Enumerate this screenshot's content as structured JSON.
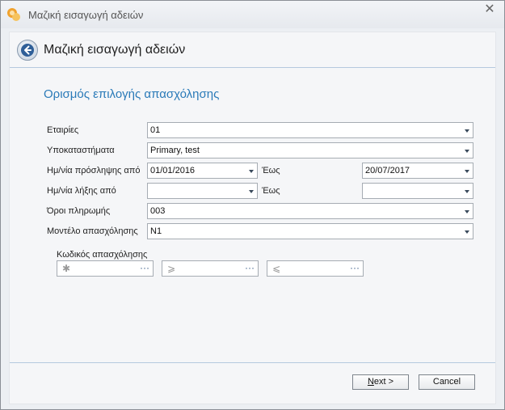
{
  "window": {
    "title": "Μαζική εισαγωγή αδειών",
    "close_glyph": "✕"
  },
  "header": {
    "title": "Μαζική εισαγωγή αδειών"
  },
  "section": {
    "title": "Ορισμός επιλογής απασχόλησης"
  },
  "fields": {
    "companies": {
      "label": "Εταιρίες",
      "value": "01"
    },
    "branches": {
      "label": "Υποκαταστήματα",
      "value": "Primary, test"
    },
    "hire_date_from": {
      "label": "Ημ/νία πρόσληψης από",
      "value": "01/01/2016"
    },
    "hire_date_to": {
      "label": "Έως",
      "value": "20/07/2017"
    },
    "end_date_from": {
      "label": "Ημ/νία λήξης από",
      "value": ""
    },
    "end_date_to": {
      "label": "Έως",
      "value": ""
    },
    "payment_terms": {
      "label": "Όροι πληρωμής",
      "value": "003"
    },
    "employment_model": {
      "label": "Μοντέλο απασχόλησης",
      "value": "N1"
    }
  },
  "employment_code": {
    "label": "Κωδικός απασχόλησης",
    "pickers": [
      {
        "glyph": "✱",
        "dots": "···"
      },
      {
        "glyph": "⩾",
        "dots": "···"
      },
      {
        "glyph": "⩽",
        "dots": "···"
      }
    ]
  },
  "buttons": {
    "next_underlined": "N",
    "next_rest": "ext >",
    "cancel": "Cancel"
  },
  "colors": {
    "accent": "#2a7ab8",
    "divider": "#b5c9de"
  },
  "icons": {
    "app": "app-logo-icon",
    "back": "back-arrow-icon",
    "dropdown": "dropdown-arrow-icon",
    "ellipsis": "ellipsis-icon"
  }
}
